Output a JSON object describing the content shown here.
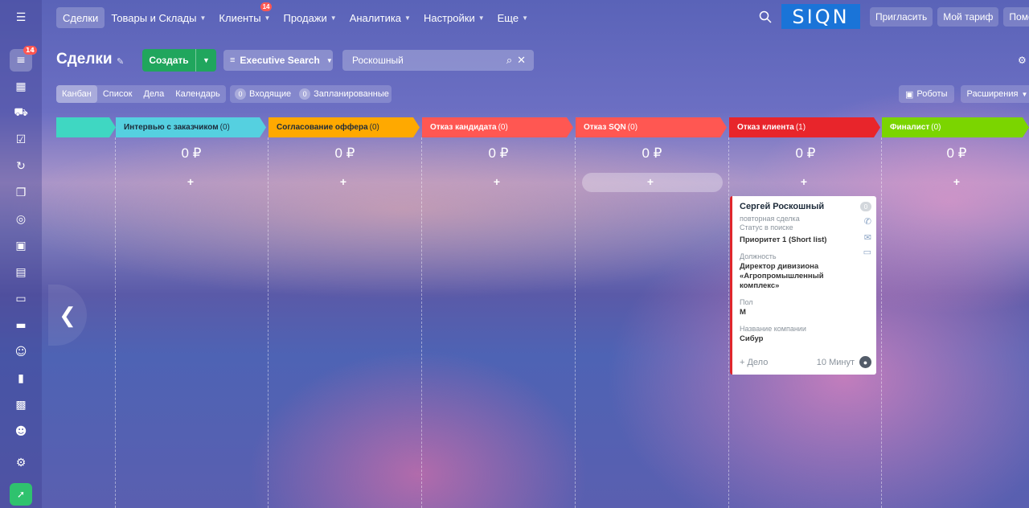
{
  "leftbar": {
    "badge": "14"
  },
  "topnav": {
    "items": [
      {
        "label": "Сделки"
      },
      {
        "label": "Товары и Склады"
      },
      {
        "label": "Клиенты",
        "badge": "14"
      },
      {
        "label": "Продажи"
      },
      {
        "label": "Аналитика"
      },
      {
        "label": "Настройки"
      },
      {
        "label": "Еще"
      }
    ],
    "logo": "SIQN",
    "invite": "Пригласить",
    "tariff": "Мой тариф",
    "help": "Помощь"
  },
  "toolbar": {
    "title": "Сделки",
    "create": "Создать",
    "filter": "Executive Search",
    "search_value": "Роскошный"
  },
  "views": {
    "items": [
      "Канбан",
      "Список",
      "Дела",
      "Календарь"
    ],
    "counters": [
      {
        "count": "0",
        "label": "Входящие"
      },
      {
        "count": "0",
        "label": "Запланированные"
      }
    ],
    "robots": "Роботы",
    "extensions": "Расширения"
  },
  "kanban": {
    "columns": [
      {
        "title": "",
        "count": "",
        "color": "#3fd7c2",
        "sum": ""
      },
      {
        "title": "Интервью с заказчиком",
        "count": "(0)",
        "color": "#55d0e0",
        "sum": "0 ₽"
      },
      {
        "title": "Согласование оффера",
        "count": "(0)",
        "color": "#ffa900",
        "sum": "0 ₽"
      },
      {
        "title": "Отказ кандидата",
        "count": "(0)",
        "color": "#ff5752",
        "sum": "0 ₽"
      },
      {
        "title": "Отказ SQN",
        "count": "(0)",
        "color": "#ff5752",
        "sum": "0 ₽"
      },
      {
        "title": "Отказ клиента",
        "count": "(1)",
        "color": "#e8252b",
        "sum": "0 ₽"
      },
      {
        "title": "Финалист",
        "count": "(0)",
        "color": "#7bd500",
        "sum": "0 ₽"
      }
    ],
    "plus": "+"
  },
  "card": {
    "name": "Сергей Роскошный",
    "counter": "0",
    "line1": "повторная сделка",
    "line2": "Статус в поиске",
    "priority": "Приоритет 1 (Short list)",
    "position_label": "Должность",
    "position_value": "Директор дивизиона «Агропромышленный комплекс»",
    "gender_label": "Пол",
    "gender_value": "М",
    "company_label": "Название компании",
    "company_value": "Сибур",
    "add_task": "+ Дело",
    "time": "10 Минут"
  }
}
